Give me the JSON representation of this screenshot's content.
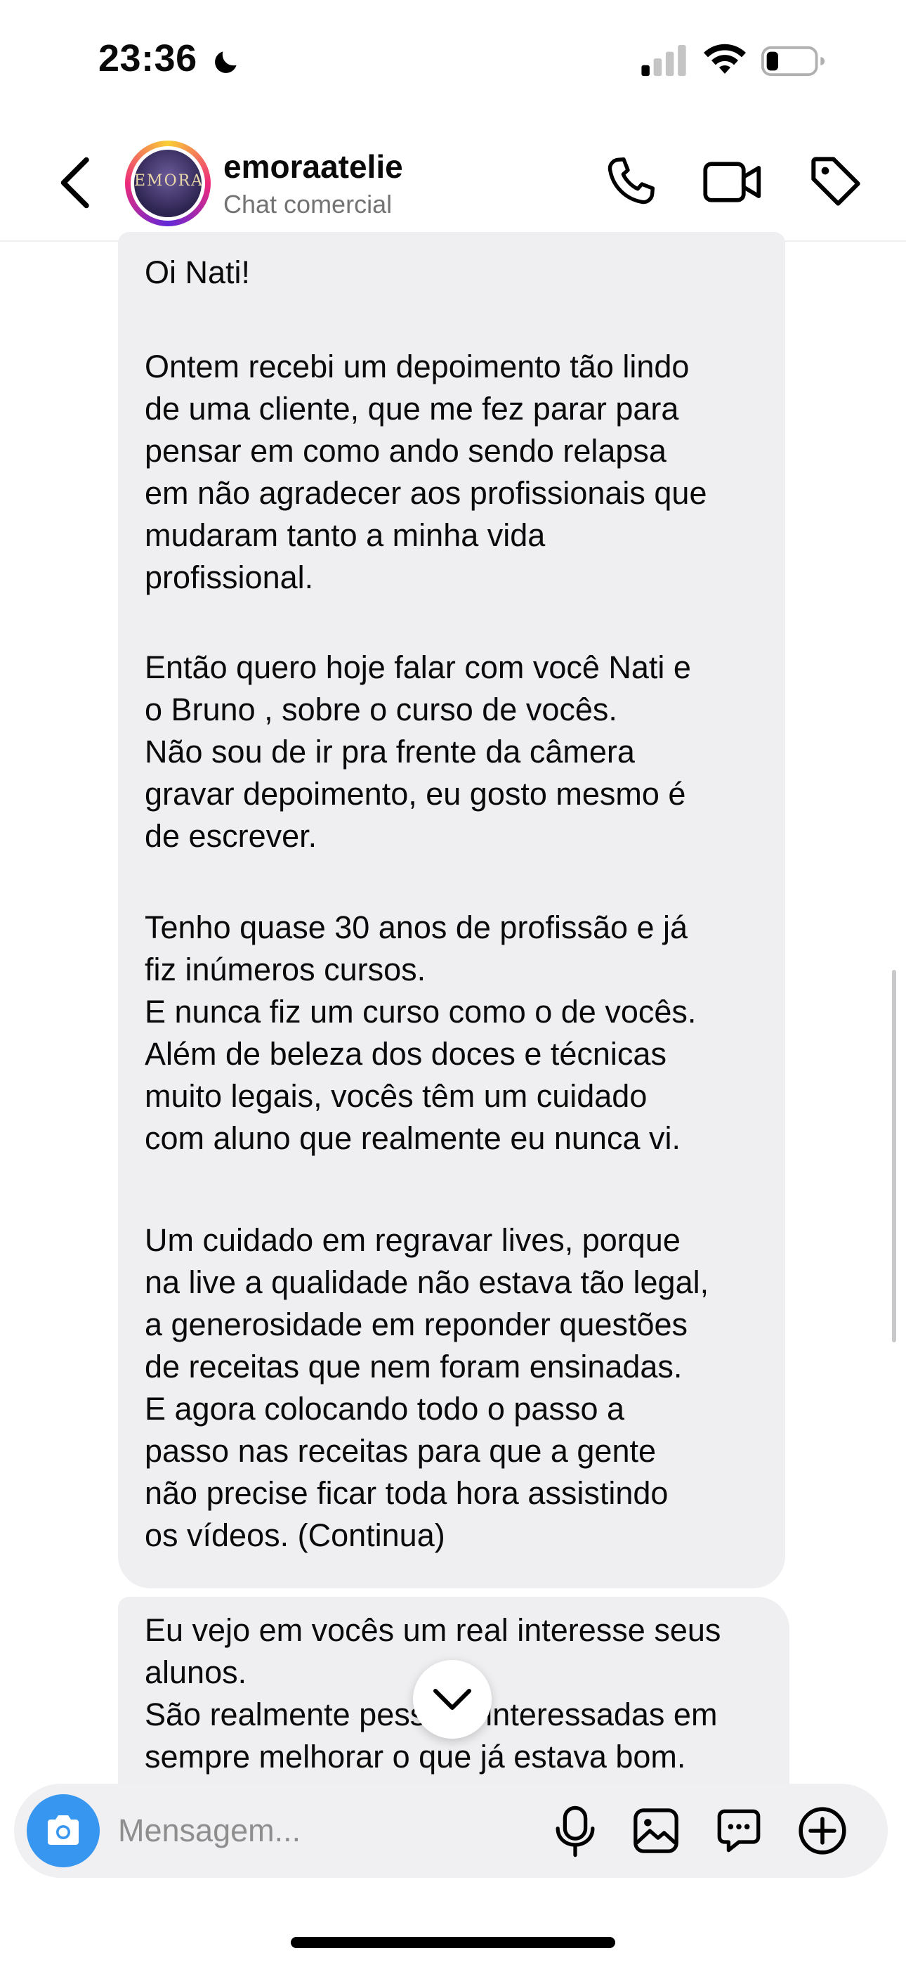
{
  "status_bar": {
    "time": "23:36",
    "battery_level": 0.25
  },
  "header": {
    "username": "emoraatelie",
    "subtitle": "Chat comercial",
    "avatar_text": "EMORA"
  },
  "messages": [
    {
      "paragraphs": [
        "Oi Nati!",
        "Ontem recebi um depoimento tão lindo\nde uma cliente, que me fez parar para\npensar em como ando sendo relapsa\nem não agradecer aos profissionais que\nmudaram tanto a minha vida\nprofissional.",
        "Então quero hoje falar com você Nati e\no Bruno , sobre o curso de vocês.\nNão sou de ir pra frente da câmera\ngravar depoimento, eu gosto mesmo é\nde escrever.",
        "Tenho quase 30 anos de profissão e já\nfiz  inúmeros cursos.\nE nunca fiz um curso como o de vocês.\nAlém de beleza dos doces e técnicas\nmuito legais, vocês têm um cuidado\ncom aluno que realmente eu nunca vi.",
        "Um cuidado em regravar lives, porque\nna live a qualidade não estava tão legal,\na generosidade  em reponder questões\nde receitas  que nem foram ensinadas.\nE agora colocando todo o passo a\npasso nas receitas para que a gente\nnão precise ficar toda hora assistindo\nos vídeos. (Continua)"
      ]
    },
    {
      "paragraphs": [
        "Eu vejo em vocês um real interesse seus\nalunos.\nSão realmente pessoas interessadas em\nsempre melhorar o que já estava bom."
      ]
    }
  ],
  "composer": {
    "placeholder": "Mensagem..."
  },
  "icons": {
    "back": "chevron-left-icon",
    "phone": "phone-icon",
    "video": "video-camera-icon",
    "tag": "tag-icon",
    "camera": "camera-icon",
    "mic": "microphone-icon",
    "gallery": "image-icon",
    "sticker": "sticker-icon",
    "plus": "plus-circle-icon",
    "scroll": "chevron-down-icon"
  },
  "colors": {
    "accent": "#3797f0",
    "bubble": "#efeff1",
    "secondary_text": "#737373"
  }
}
